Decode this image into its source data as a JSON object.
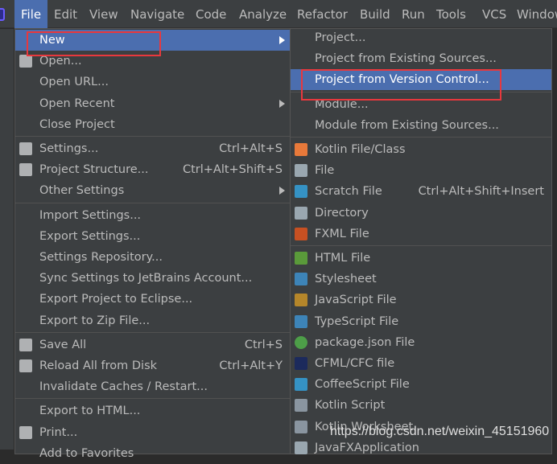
{
  "menubar": [
    "File",
    "Edit",
    "View",
    "Navigate",
    "Code",
    "Analyze",
    "Refactor",
    "Build",
    "Run",
    "Tools",
    "VCS",
    "Window"
  ],
  "file_menu": [
    {
      "label": "New",
      "arrow": true,
      "selected": true
    },
    {
      "label": "Open...",
      "icon": "folder-open-icon"
    },
    {
      "label": "Open URL..."
    },
    {
      "label": "Open Recent",
      "arrow": true
    },
    {
      "label": "Close Project"
    },
    {
      "sep": true
    },
    {
      "label": "Settings...",
      "shortcut": "Ctrl+Alt+S",
      "icon": "wrench-icon"
    },
    {
      "label": "Project Structure...",
      "shortcut": "Ctrl+Alt+Shift+S",
      "icon": "project-structure-icon"
    },
    {
      "label": "Other Settings",
      "arrow": true
    },
    {
      "sep": true
    },
    {
      "label": "Import Settings..."
    },
    {
      "label": "Export Settings..."
    },
    {
      "label": "Settings Repository..."
    },
    {
      "label": "Sync Settings to JetBrains Account..."
    },
    {
      "label": "Export Project to Eclipse..."
    },
    {
      "label": "Export to Zip File..."
    },
    {
      "sep": true
    },
    {
      "label": "Save All",
      "shortcut": "Ctrl+S",
      "icon": "save-icon"
    },
    {
      "label": "Reload All from Disk",
      "shortcut": "Ctrl+Alt+Y",
      "icon": "reload-icon"
    },
    {
      "label": "Invalidate Caches / Restart..."
    },
    {
      "sep": true
    },
    {
      "label": "Export to HTML..."
    },
    {
      "label": "Print...",
      "icon": "print-icon"
    },
    {
      "label": "Add to Favorites"
    }
  ],
  "new_submenu": [
    {
      "label": "Project..."
    },
    {
      "label": "Project from Existing Sources..."
    },
    {
      "label": "Project from Version Control...",
      "selected": true
    },
    {
      "sep": true
    },
    {
      "label": "Module..."
    },
    {
      "label": "Module from Existing Sources..."
    },
    {
      "sep": true
    },
    {
      "label": "Kotlin File/Class",
      "icon": "kotlin-file-icon"
    },
    {
      "label": "File",
      "icon": "file-icon"
    },
    {
      "label": "Scratch File",
      "shortcut": "Ctrl+Alt+Shift+Insert",
      "icon": "scratch-file-icon"
    },
    {
      "label": "Directory",
      "icon": "folder-icon"
    },
    {
      "label": "FXML File",
      "icon": "fxml-file-icon"
    },
    {
      "sep": true
    },
    {
      "label": "HTML File",
      "icon": "html-file-icon"
    },
    {
      "label": "Stylesheet",
      "icon": "css-file-icon"
    },
    {
      "label": "JavaScript File",
      "icon": "js-file-icon"
    },
    {
      "label": "TypeScript File",
      "icon": "ts-file-icon"
    },
    {
      "label": "package.json File",
      "icon": "nodejs-icon"
    },
    {
      "label": "CFML/CFC file",
      "icon": "cfml-icon"
    },
    {
      "label": "CoffeeScript File",
      "icon": "coffeescript-icon"
    },
    {
      "label": "Kotlin Script",
      "icon": "kotlin-script-icon"
    },
    {
      "label": "Kotlin Worksheet",
      "icon": "kotlin-worksheet-icon"
    },
    {
      "label": "JavaFXApplication",
      "icon": "javafx-icon"
    }
  ],
  "watermark": "https://blog.csdn.net/weixin_45151960",
  "colors": {
    "selection": "#4b6eaf",
    "menu_bg": "#3c3f41",
    "highlight_box": "#e8383d"
  }
}
